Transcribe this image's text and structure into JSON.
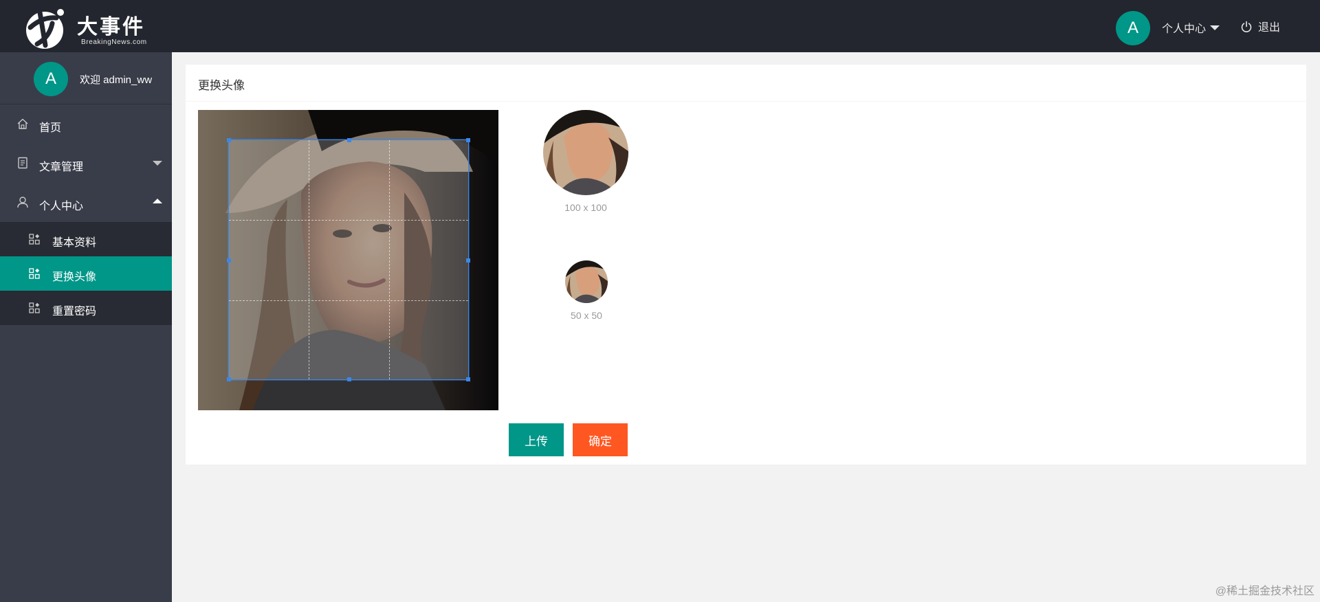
{
  "header": {
    "logo_text": "大事件",
    "logo_sub": "BreakingNews.com",
    "avatar_letter": "A",
    "user_menu_label": "个人中心",
    "logout_label": "退出"
  },
  "sidebar": {
    "avatar_letter": "A",
    "welcome_text": "欢迎  admin_ww",
    "items": [
      {
        "label": "首页",
        "icon": "home-icon"
      },
      {
        "label": "文章管理",
        "icon": "document-icon",
        "expanded": false
      },
      {
        "label": "个人中心",
        "icon": "user-icon",
        "expanded": true
      }
    ],
    "sub_items": [
      {
        "label": "基本资料",
        "icon": "grid-icon",
        "active": false
      },
      {
        "label": "更换头像",
        "icon": "grid-icon",
        "active": true
      },
      {
        "label": "重置密码",
        "icon": "grid-icon",
        "active": false
      }
    ]
  },
  "card": {
    "title": "更换头像",
    "preview_large_caption": "100 x 100",
    "preview_small_caption": "50 x 50",
    "upload_label": "上传",
    "confirm_label": "确定"
  },
  "watermark": "@稀土掘金技术社区",
  "colors": {
    "header_bg": "#23262e",
    "sidebar_bg": "#393d49",
    "submenu_bg": "#282b33",
    "accent": "#009688",
    "confirm": "#ff5722",
    "crop_border": "#3b87e8"
  }
}
